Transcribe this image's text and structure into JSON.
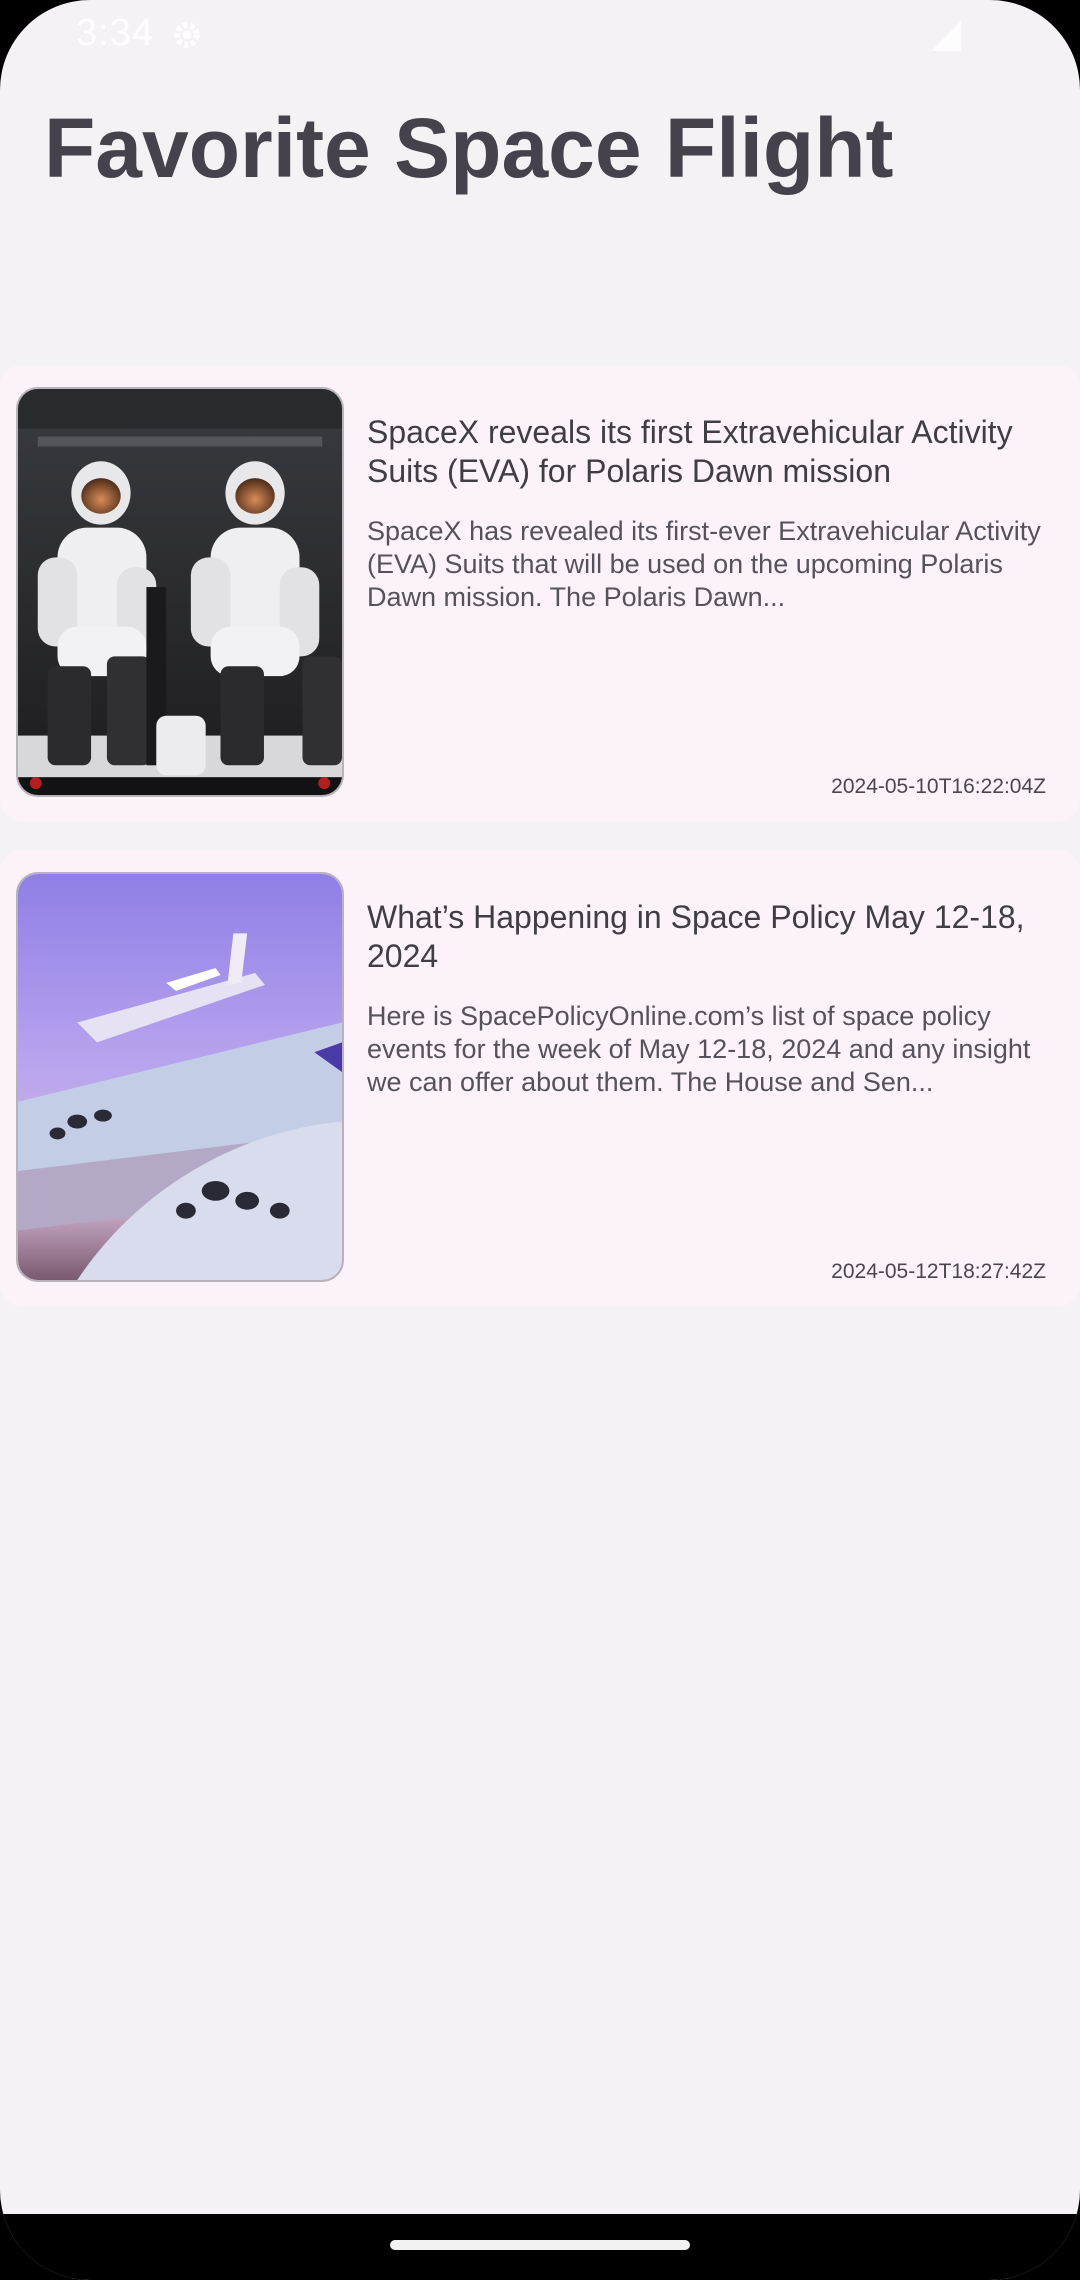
{
  "status_bar": {
    "time": "3:34",
    "icons": [
      "gear-icon",
      "signal-icon"
    ]
  },
  "header": {
    "title": "Favorite Space Flight"
  },
  "articles": [
    {
      "image": "astronauts-eva-suits-image",
      "title": "SpaceX reveals its first Extravehicular Activity Suits (EVA) for Polaris Dawn mission",
      "summary": "SpaceX has revealed its first-ever Extravehicular Activity (EVA) Suits that will be used on the upcoming Polaris Dawn mission. The Polaris Dawn...",
      "published": "2024-05-10T16:22:04Z"
    },
    {
      "image": "spaceplane-image",
      "title": "What’s Happening in Space Policy May 12-18, 2024",
      "summary": "Here is SpacePolicyOnline.com’s list of space policy events for the week of May 12-18, 2024 and any insight we can offer about them. The House and Sen...",
      "published": "2024-05-12T18:27:42Z"
    }
  ],
  "colors": {
    "background": "#f5f2f5",
    "card": "#fcf3fa",
    "title_text": "#45424c"
  }
}
